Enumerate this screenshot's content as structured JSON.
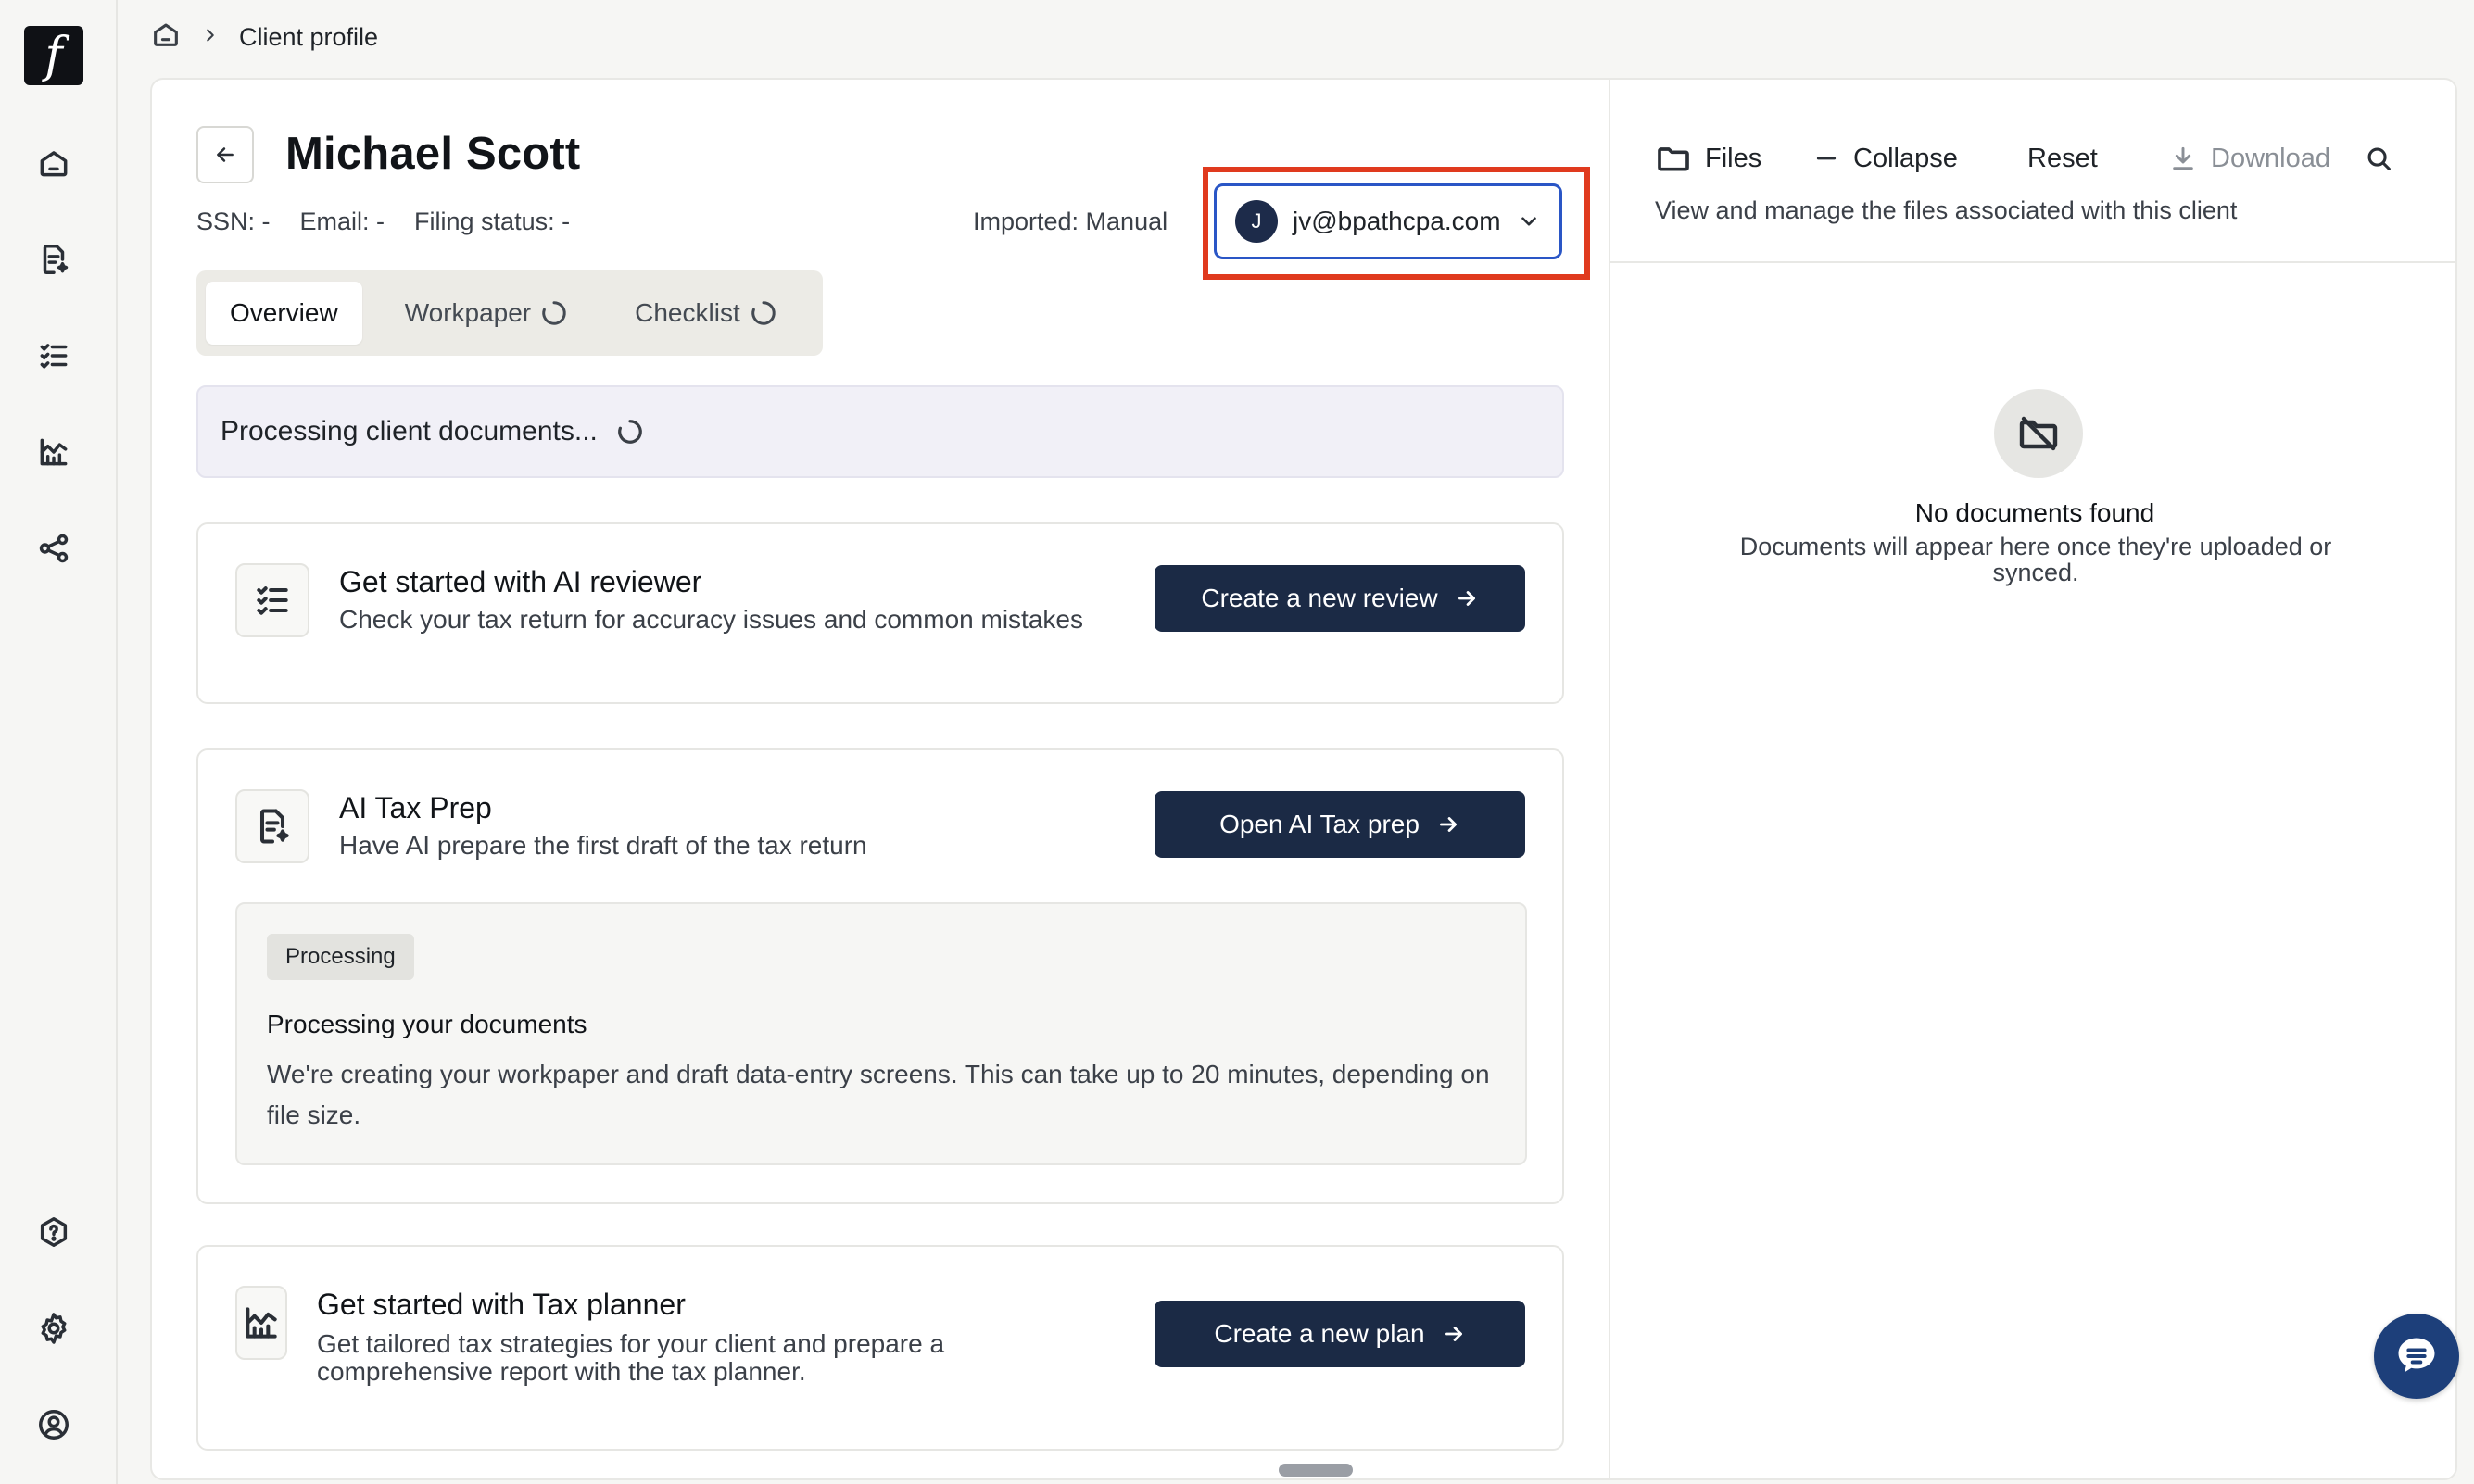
{
  "app": {
    "logo_glyph": "f"
  },
  "breadcrumb": {
    "current": "Client profile"
  },
  "client": {
    "name": "Michael Scott",
    "ssn_label": "SSN: -",
    "email_label": "Email: -",
    "filing_status_label": "Filing status: -",
    "imported": "Imported: Manual"
  },
  "user_select": {
    "avatar_initial": "J",
    "email": "jv@bpathcpa.com"
  },
  "tabs": [
    {
      "label": "Overview",
      "active": true
    },
    {
      "label": "Workpaper",
      "loading": true
    },
    {
      "label": "Checklist",
      "loading": true
    }
  ],
  "processing_banner": "Processing client documents...",
  "cards": {
    "reviewer": {
      "title": "Get started with AI reviewer",
      "desc": "Check your tax return for accuracy issues and common mistakes",
      "cta": "Create a new review"
    },
    "tax_prep": {
      "title": "AI Tax Prep",
      "desc": "Have AI prepare the first draft of the tax return",
      "cta": "Open AI Tax prep",
      "status_badge": "Processing",
      "status_title": "Processing your documents",
      "status_desc": "We're creating your workpaper and draft data-entry screens. This can take up to 20 minutes, depending on file size."
    },
    "planner": {
      "title": "Get started with Tax planner",
      "desc": "Get tailored tax strategies for your client and prepare a comprehensive report with the tax planner.",
      "cta": "Create a new plan"
    }
  },
  "files_panel": {
    "files": "Files",
    "collapse": "Collapse",
    "reset": "Reset",
    "download": "Download",
    "subtitle": "View and manage the files associated with this client",
    "empty_title": "No documents found",
    "empty_desc": "Documents will appear here once they're uploaded or synced."
  },
  "icons": {
    "nav": [
      "home-icon",
      "document-sparkle-icon",
      "checklist-icon",
      "chart-icon",
      "share-icon",
      "help-icon",
      "settings-icon",
      "user-circle-icon"
    ]
  },
  "colors": {
    "primary": "#1b2a45",
    "highlight": "#e03a1e",
    "focus": "#2a56c6",
    "chat": "#1d3f7a"
  }
}
